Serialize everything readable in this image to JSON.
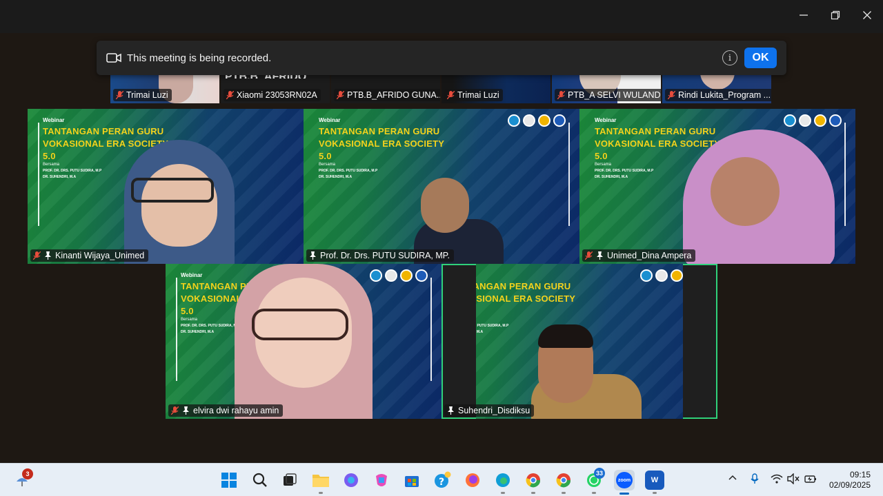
{
  "window": {
    "minimize_icon": "minimize-icon",
    "maximize_icon": "restore-icon",
    "close_icon": "close-icon"
  },
  "banner": {
    "message": "This meeting is being recorded.",
    "ok_label": "OK",
    "info_glyph": "i"
  },
  "strip": {
    "tiles": [
      {
        "name": "Trimai Luzi"
      },
      {
        "name": "Xiaomi 23053RN02A"
      },
      {
        "name": "PTB.B_AFRIDO GUNA..."
      },
      {
        "name": "Trimai Luzi"
      },
      {
        "name": "PTB_A SELVI WULAND..."
      },
      {
        "name": "Rindi Lukita_Program ..."
      }
    ],
    "partial_text": "Xiaomi  23053RN  PTB.B_AFRIDO"
  },
  "slide": {
    "webinar": "Webinar",
    "title_lines": [
      "TANTANGAN PERAN GURU",
      "VOKASIONAL ERA SOCIETY",
      "5.0"
    ],
    "bersama": "Bersama",
    "names": [
      "PROF. DR. DRS. PUTU SUDIRA, M.P",
      "DR. SUHENDRI, M.A"
    ]
  },
  "tiles": [
    {
      "name": "Kinanti Wijaya_Unimed"
    },
    {
      "name": "Prof. Dr. Drs. PUTU SUDIRA, MP."
    },
    {
      "name": "Unimed_Dina Ampera"
    },
    {
      "name": "elvira dwi rahayu amin"
    },
    {
      "name": "Suhendri_Disdiksu"
    }
  ],
  "taskbar": {
    "weather_badge": "3",
    "whatsapp_badge": "33",
    "zoom_label": "zoom",
    "word_label": "W",
    "time": "09:15",
    "date": "02/09/2025"
  },
  "colors": {
    "recording_ok": "#0e72ed",
    "active_speaker": "#2fd27b",
    "slide_title": "#f3d21c"
  }
}
